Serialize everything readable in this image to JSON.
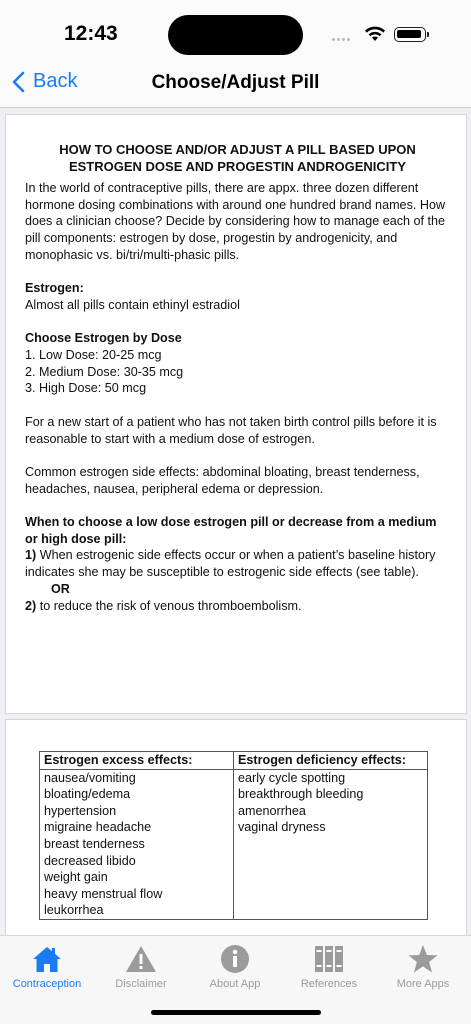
{
  "status": {
    "time": "12:43"
  },
  "nav": {
    "back_label": "Back",
    "title": "Choose/Adjust Pill"
  },
  "article": {
    "heading": "HOW TO CHOOSE AND/OR ADJUST A PILL BASED UPON ESTROGEN DOSE AND PROGESTIN ANDROGENICITY",
    "intro": "In the world of contraceptive pills, there are appx. three dozen different hormone dosing combinations with around one hundred brand names.  How does a clinician choose?   Decide by considering how to manage each of the pill components: estrogen by dose, progestin by androgenicity, and monophasic vs. bi/tri/multi-phasic pills.",
    "estrogen_title": "Estrogen:",
    "estrogen_text": "Almost all pills contain ethinyl estradiol",
    "dose_title": "Choose Estrogen by Dose",
    "doses": [
      "1. Low Dose: 20-25 mcg",
      "2. Medium Dose: 30-35 mcg",
      "3. High Dose: 50 mcg"
    ],
    "new_start": "For a new start of a patient who has not taken birth control pills before it is reasonable to start with a medium dose of estrogen.",
    "side_effects": "Common estrogen side effects: abdominal bloating, breast tenderness, headaches, nausea, peripheral edema or depression.",
    "when_title": "When to choose a low dose estrogen pill or decrease from a medium or high dose pill:",
    "reason1_num": "1)",
    "reason1_text": " When estrogenic side effects occur or when a patient’s baseline history indicates she may be susceptible to estrogenic side effects (see table).",
    "or_label": "OR",
    "reason2_num": "2)",
    "reason2_text": " to reduce the risk of venous thromboembolism."
  },
  "table": {
    "col1_header": "Estrogen excess effects:",
    "col2_header": "Estrogen deficiency effects:",
    "excess": [
      "nausea/vomiting",
      "bloating/edema",
      "hypertension",
      "migraine headache",
      "breast tenderness",
      "decreased libido",
      "weight gain",
      "heavy menstrual flow",
      "leukorrhea"
    ],
    "deficiency": [
      "early cycle spotting",
      "breakthrough bleeding",
      "amenorrhea",
      "vaginal dryness"
    ]
  },
  "tabs": [
    {
      "label": "Contraception",
      "icon": "home-icon",
      "active": true
    },
    {
      "label": "Disclaimer",
      "icon": "warning-icon",
      "active": false
    },
    {
      "label": "About App",
      "icon": "info-icon",
      "active": false
    },
    {
      "label": "References",
      "icon": "books-icon",
      "active": false
    },
    {
      "label": "More Apps",
      "icon": "star-icon",
      "active": false
    }
  ],
  "colors": {
    "accent": "#1a7cf5",
    "inactive": "#9b9b9b"
  }
}
